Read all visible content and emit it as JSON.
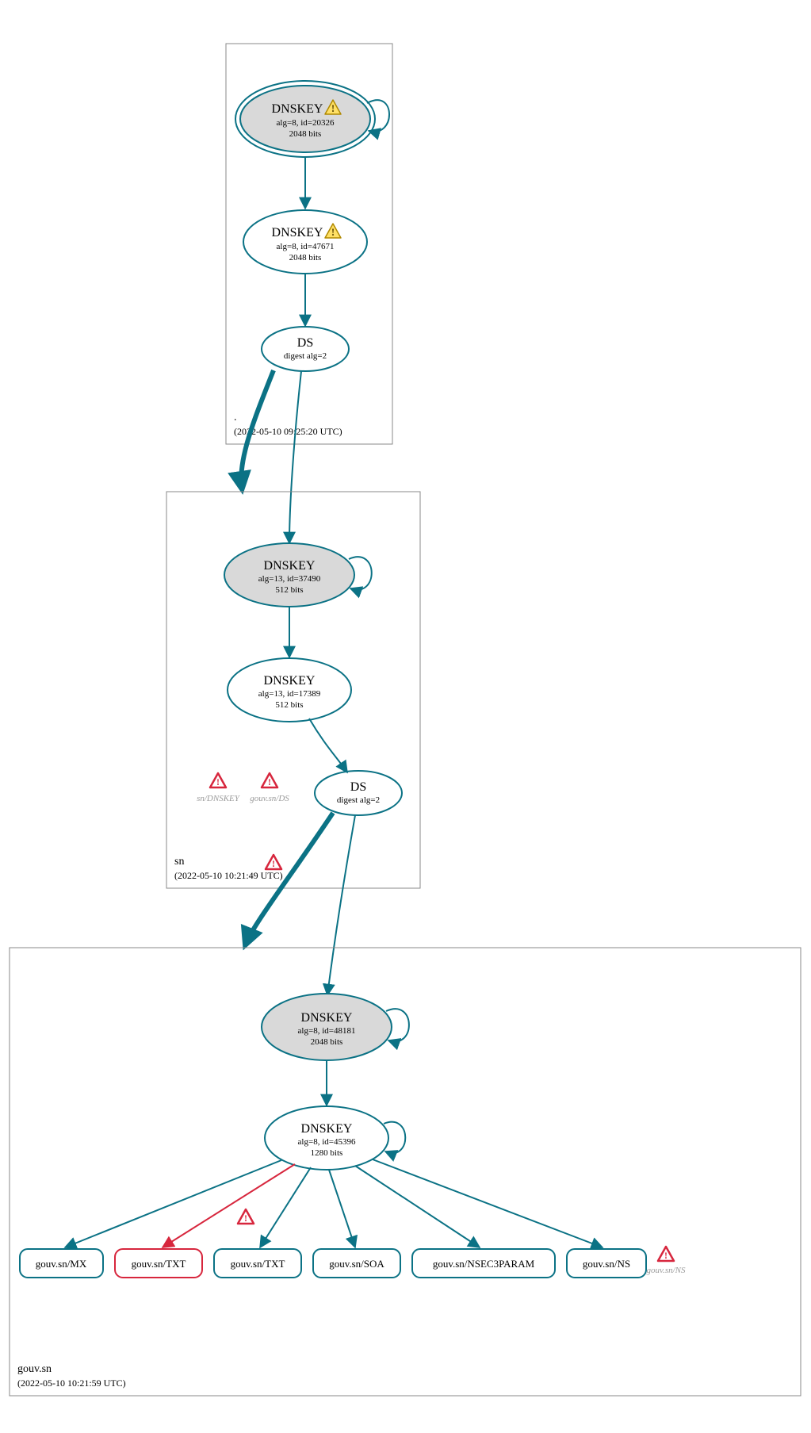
{
  "zones": {
    "root": {
      "name": ".",
      "timestamp": "(2022-05-10 09:25:20 UTC)"
    },
    "sn": {
      "name": "sn",
      "timestamp": "(2022-05-10 10:21:49 UTC)"
    },
    "gouv": {
      "name": "gouv.sn",
      "timestamp": "(2022-05-10 10:21:59 UTC)"
    }
  },
  "nodes": {
    "root_ksk": {
      "title": "DNSKEY",
      "line2": "alg=8, id=20326",
      "line3": "2048 bits",
      "warn": true
    },
    "root_zsk": {
      "title": "DNSKEY",
      "line2": "alg=8, id=47671",
      "line3": "2048 bits",
      "warn": true
    },
    "root_ds": {
      "title": "DS",
      "line2": "digest alg=2"
    },
    "sn_ksk": {
      "title": "DNSKEY",
      "line2": "alg=13, id=37490",
      "line3": "512 bits"
    },
    "sn_zsk": {
      "title": "DNSKEY",
      "line2": "alg=13, id=17389",
      "line3": "512 bits"
    },
    "sn_ds": {
      "title": "DS",
      "line2": "digest alg=2"
    },
    "gouv_ksk": {
      "title": "DNSKEY",
      "line2": "alg=8, id=48181",
      "line3": "2048 bits"
    },
    "gouv_zsk": {
      "title": "DNSKEY",
      "line2": "alg=8, id=45396",
      "line3": "1280 bits"
    }
  },
  "records": {
    "mx": {
      "label": "gouv.sn/MX"
    },
    "txt1": {
      "label": "gouv.sn/TXT"
    },
    "txt2": {
      "label": "gouv.sn/TXT"
    },
    "soa": {
      "label": "gouv.sn/SOA"
    },
    "nsec": {
      "label": "gouv.sn/NSEC3PARAM"
    },
    "ns": {
      "label": "gouv.sn/NS"
    }
  },
  "ghosts": {
    "sn_dnskey": "sn/DNSKEY",
    "gouv_ds": "gouv.sn/DS",
    "gouv_ns": "gouv.sn/NS"
  }
}
